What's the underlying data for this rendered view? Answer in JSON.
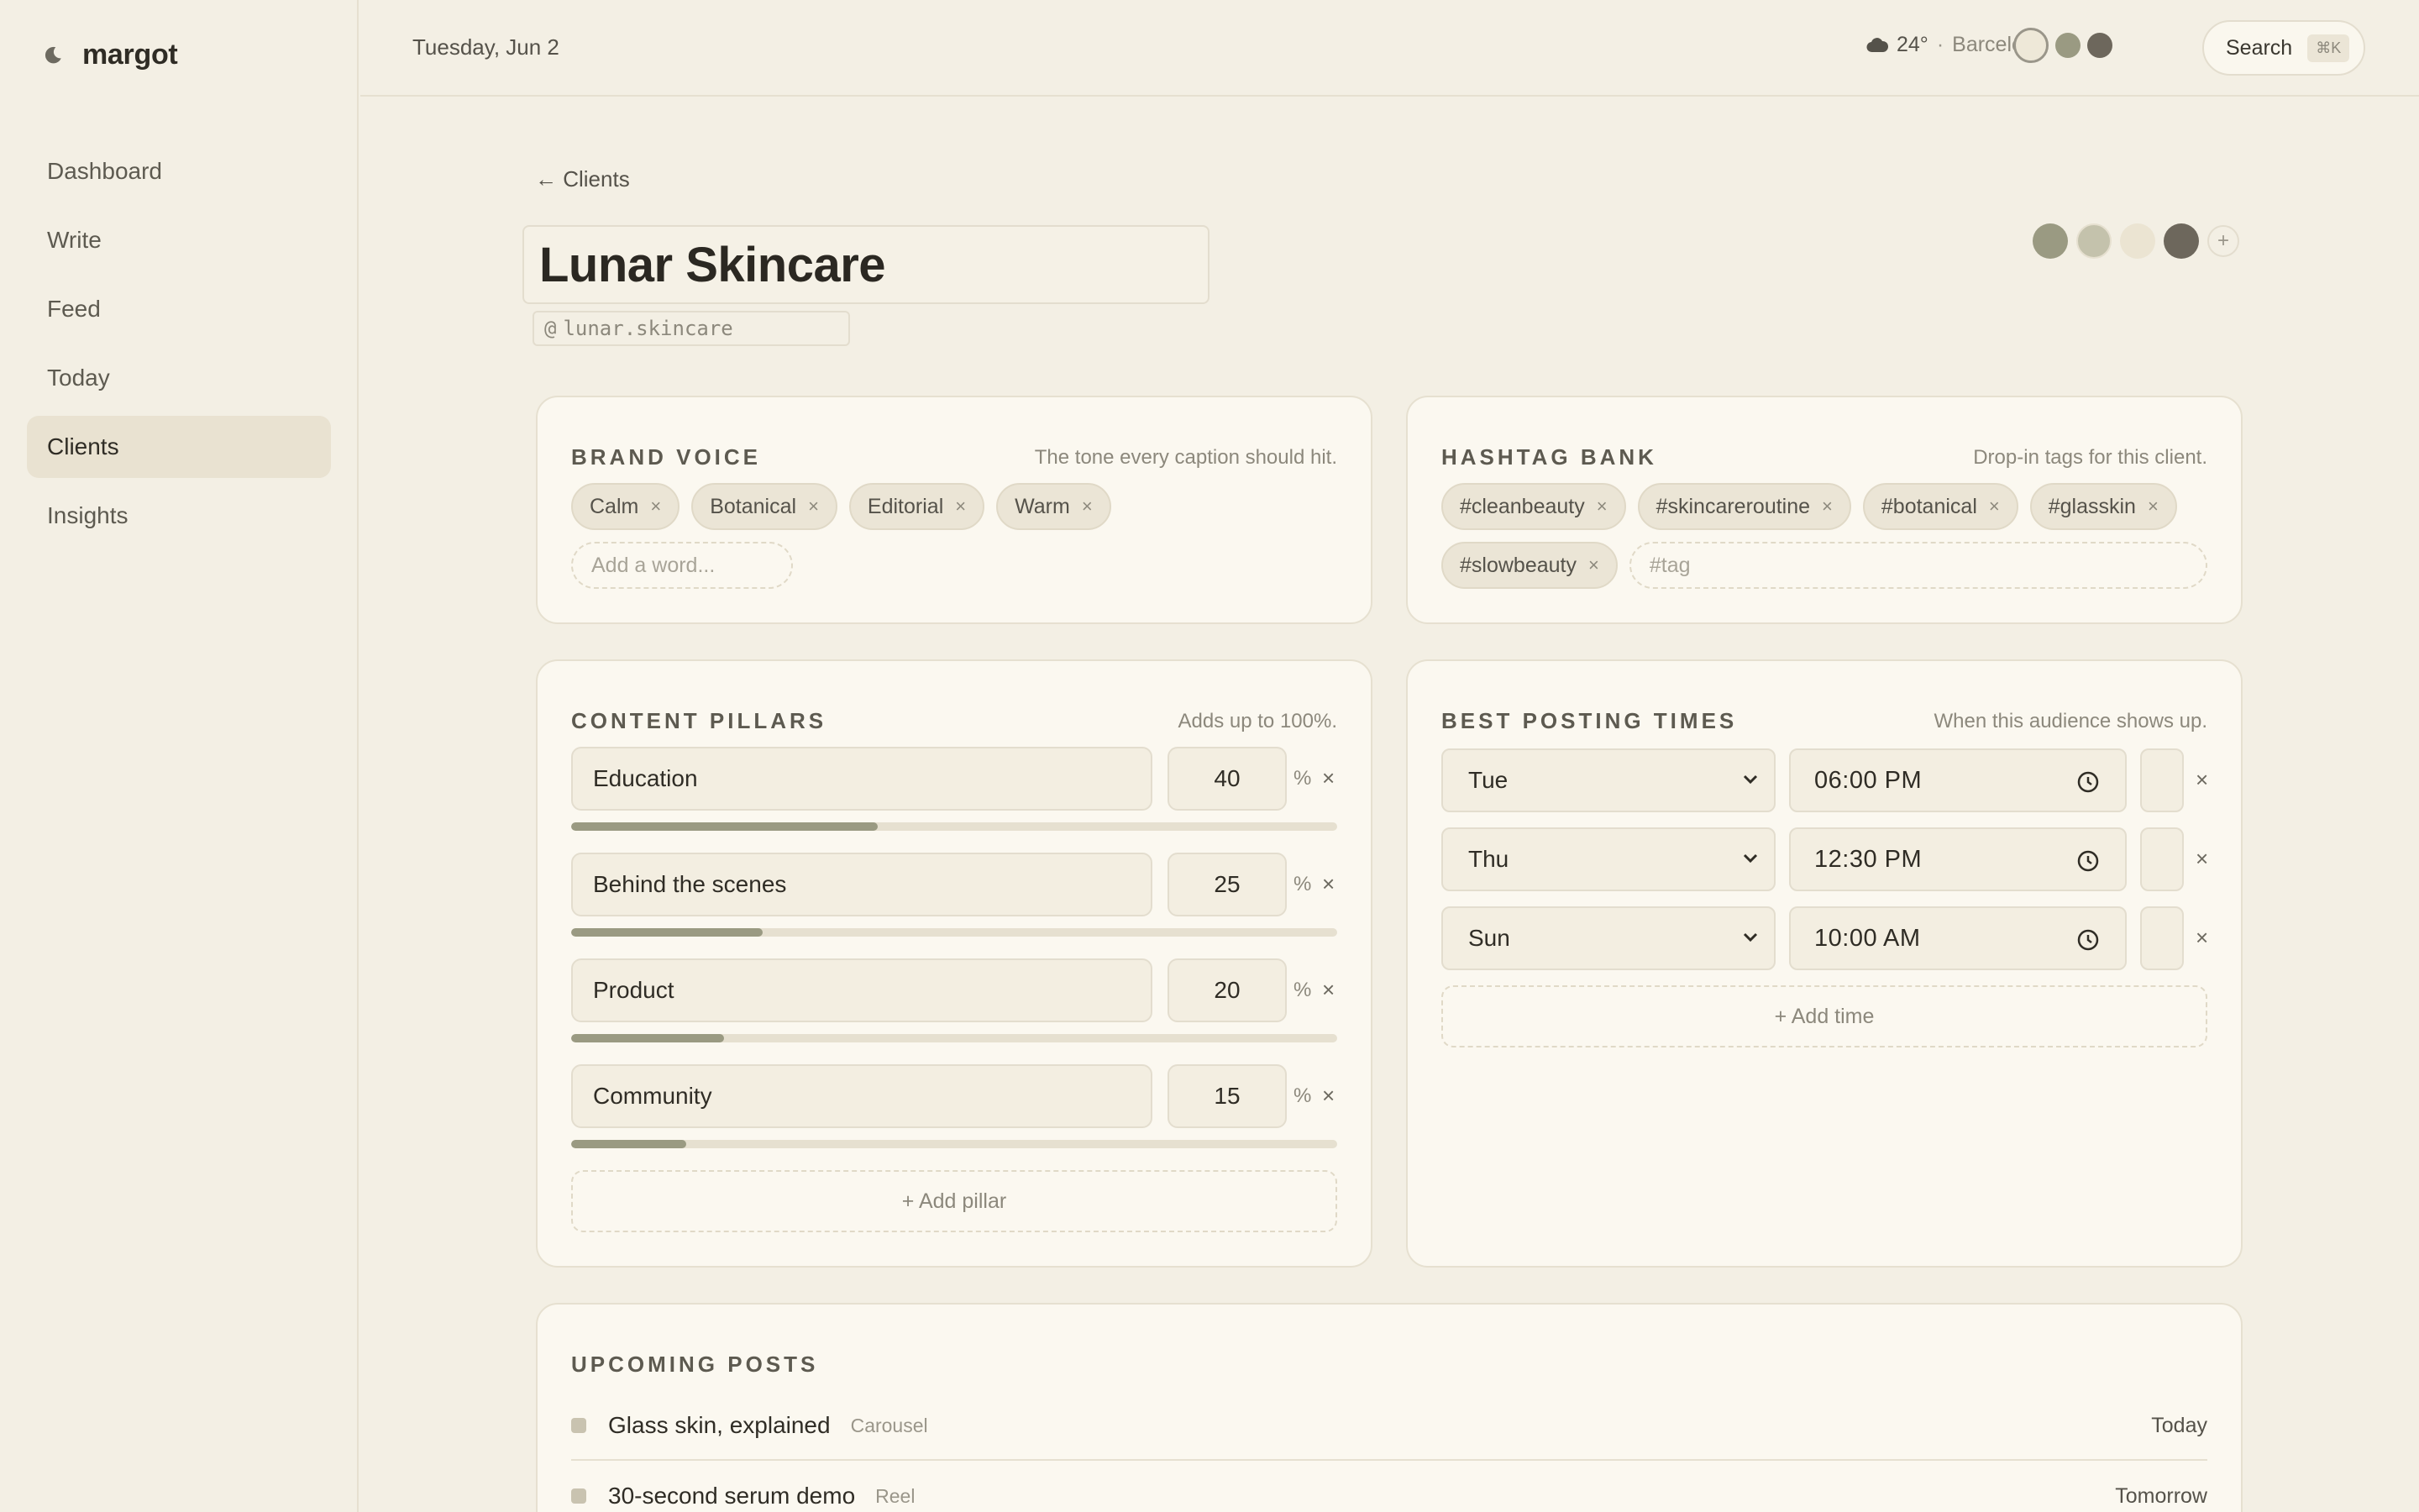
{
  "app": {
    "name": "margot"
  },
  "sidebar": {
    "items": [
      {
        "label": "Dashboard"
      },
      {
        "label": "Write"
      },
      {
        "label": "Feed"
      },
      {
        "label": "Today"
      },
      {
        "label": "Clients",
        "active": true
      },
      {
        "label": "Insights"
      }
    ]
  },
  "topbar": {
    "date": "Tuesday, Jun 2",
    "weather": {
      "temp": "24°",
      "separator": "·",
      "city": "Barcelona",
      "icon": "cloud-icon"
    },
    "theme_swatches": [
      "#eee8d8",
      "#9a9a82",
      "#6d675c"
    ],
    "search_label": "Search",
    "search_shortcut": "⌘K"
  },
  "client": {
    "back_label": "← Clients",
    "name": "Lunar Skincare",
    "handle_prefix": "@",
    "handle": "lunar.skincare",
    "palette": [
      "#9a9a82",
      "#c4c2ac",
      "#ebe4d2",
      "#6d675c"
    ],
    "palette_add": "+"
  },
  "brand_voice": {
    "title": "BRAND VOICE",
    "subtitle": "The tone every caption should hit.",
    "tags": [
      "Calm",
      "Botanical",
      "Editorial",
      "Warm"
    ],
    "remove": "×",
    "placeholder": "Add a word..."
  },
  "hashtag_bank": {
    "title": "HASHTAG BANK",
    "subtitle": "Drop-in tags for this client.",
    "tags": [
      "#cleanbeauty",
      "#skincareroutine",
      "#botanical",
      "#glasskin",
      "#slowbeauty"
    ],
    "remove": "×",
    "placeholder": "#tag"
  },
  "content_pillars": {
    "title": "CONTENT PILLARS",
    "subtitle": "Adds up to 100%.",
    "percent_sign": "%",
    "remove": "×",
    "items": [
      {
        "name": "Education",
        "percent": "40"
      },
      {
        "name": "Behind the scenes",
        "percent": "25"
      },
      {
        "name": "Product",
        "percent": "20"
      },
      {
        "name": "Community",
        "percent": "15"
      }
    ],
    "add_label": "+ Add pillar"
  },
  "posting_times": {
    "title": "BEST POSTING TIMES",
    "subtitle": "When this audience shows up.",
    "remove": "×",
    "items": [
      {
        "day": "Tue",
        "time": "06:00 PM"
      },
      {
        "day": "Thu",
        "time": "12:30 PM"
      },
      {
        "day": "Sun",
        "time": "10:00 AM"
      }
    ],
    "add_label": "+ Add time"
  },
  "upcoming_posts": {
    "title": "UPCOMING POSTS",
    "items": [
      {
        "title": "Glass skin, explained",
        "type": "Carousel",
        "when": "Today"
      },
      {
        "title": "30-second serum demo",
        "type": "Reel",
        "when": "Tomorrow"
      }
    ]
  }
}
